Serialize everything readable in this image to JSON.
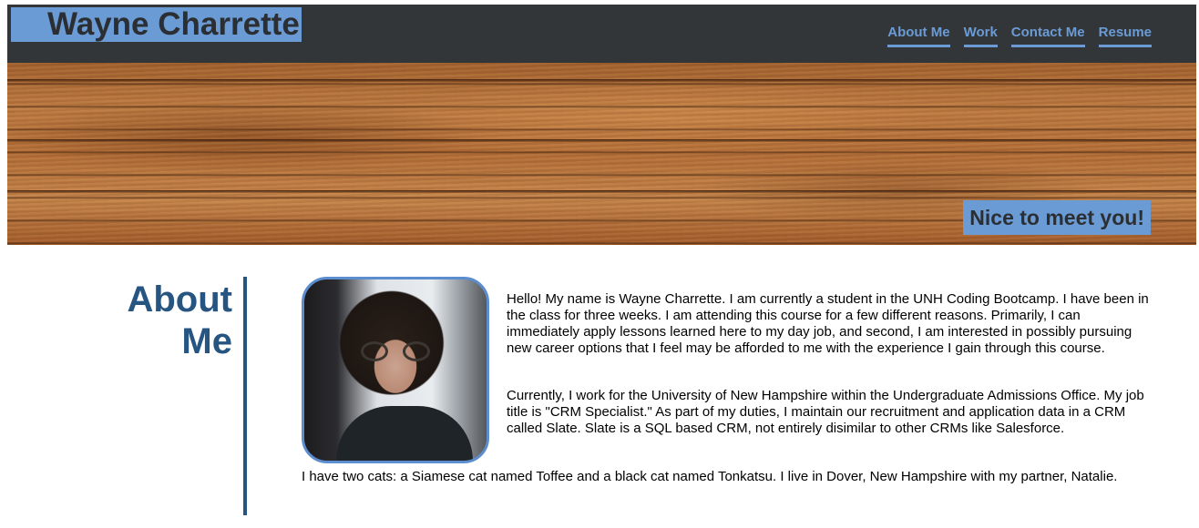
{
  "header": {
    "site_name": "Wayne Charrette",
    "nav": [
      {
        "label": "About Me"
      },
      {
        "label": "Work"
      },
      {
        "label": "Contact Me"
      },
      {
        "label": "Resume"
      }
    ]
  },
  "hero": {
    "tagline": "Nice to meet you!"
  },
  "about": {
    "heading_line1": "About",
    "heading_line2": "Me",
    "paragraphs": [
      "Hello! My name is Wayne Charrette. I am currently a student in the UNH Coding Bootcamp. I have been in the class for three weeks. I am attending this course for a few different reasons. Primarily, I can immediately apply lessons learned here to my day job, and second, I am interested in possibly pursuing new career options that I feel may be afforded to me with the experience I gain through this course.",
      "Currently, I work for the University of New Hampshire within the Undergraduate Admissions Office. My job title is \"CRM Specialist.\" As part of my duties, I maintain our recruitment and application data in a CRM called Slate. Slate is a SQL based CRM, not entirely disimilar to other CRMs like Salesforce.",
      "I have two cats: a Siamese cat named Toffee and a black cat named Tonkatsu. I live in Dover, New Hampshire with my partner, Natalie."
    ]
  },
  "colors": {
    "header_bg": "#323639",
    "accent_blue": "#6b9bd4",
    "heading_blue": "#275581"
  }
}
